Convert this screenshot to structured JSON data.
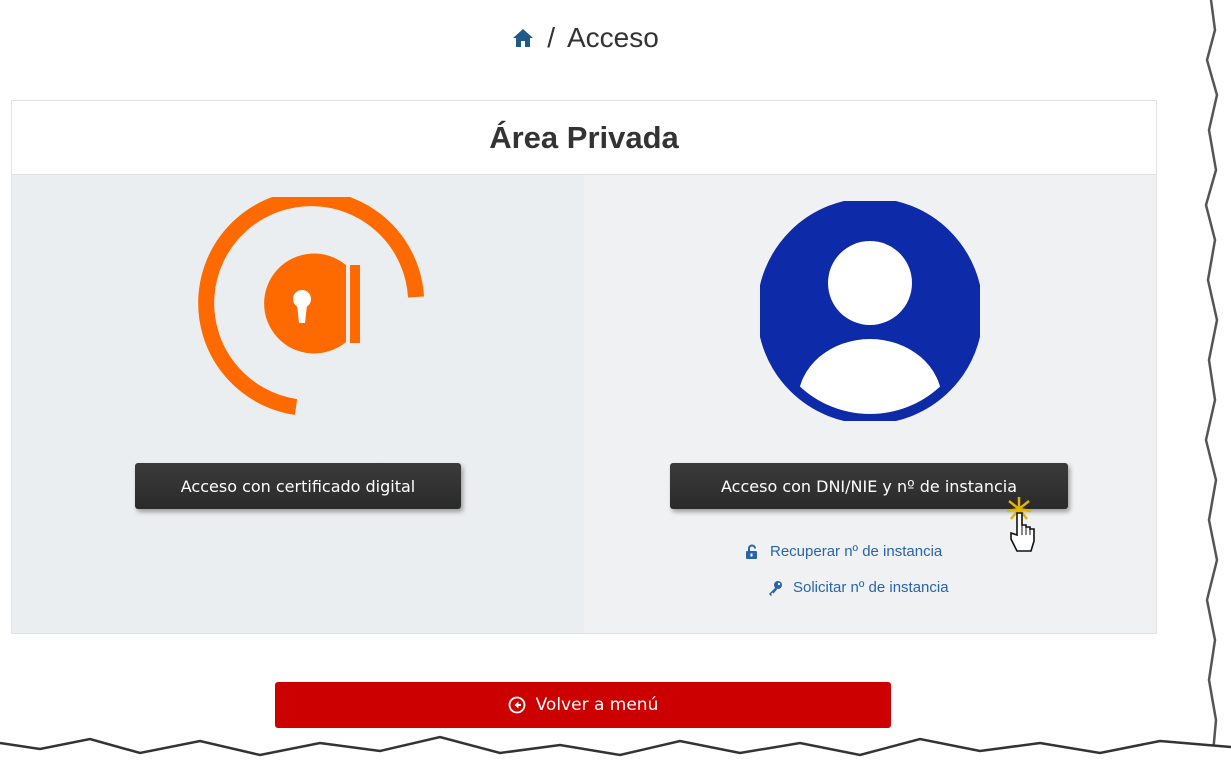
{
  "breadcrumb": {
    "separator": "/",
    "current": "Acceso"
  },
  "panel": {
    "title": "Área Privada"
  },
  "left_option": {
    "button_label": "Acceso con certificado digital"
  },
  "right_option": {
    "button_label": "Acceso con DNI/NIE y nº de instancia",
    "links": {
      "recover": "Recuperar nº de instancia",
      "request": "Solicitar nº de instancia"
    }
  },
  "footer": {
    "back_label": "Volver a menú"
  },
  "colors": {
    "cert_orange": "#ff6a00",
    "user_blue": "#0d2aa8",
    "link_blue": "#2a64a8",
    "back_red": "#cc0000",
    "dark_button": "#2f2f2f"
  },
  "icons": [
    "home-icon",
    "certificate-icon",
    "user-avatar-icon",
    "unlock-icon",
    "key-icon",
    "back-circle-icon",
    "hand-cursor-icon"
  ]
}
